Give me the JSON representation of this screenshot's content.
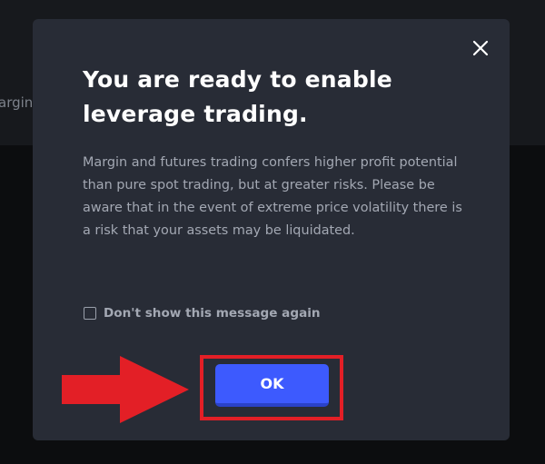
{
  "background": {
    "partial_text": "argin"
  },
  "modal": {
    "title": "You are ready to enable leverage trading.",
    "body": "Margin and futures trading confers higher profit potential than pure spot trading, but at greater risks. Please be aware that in the event of extreme price volatility there is a risk that your assets may be liquidated.",
    "checkbox_label": "Don't show this message again",
    "checkbox_checked": false,
    "ok_label": "OK",
    "close_icon": "close-icon"
  },
  "annotation": {
    "arrow_icon": "red-arrow-icon",
    "highlight_color": "#e31f26"
  },
  "colors": {
    "modal_bg": "#282c36",
    "primary_button": "#3d5afe",
    "title_text": "#ffffff",
    "body_text": "#a3a8b3"
  }
}
